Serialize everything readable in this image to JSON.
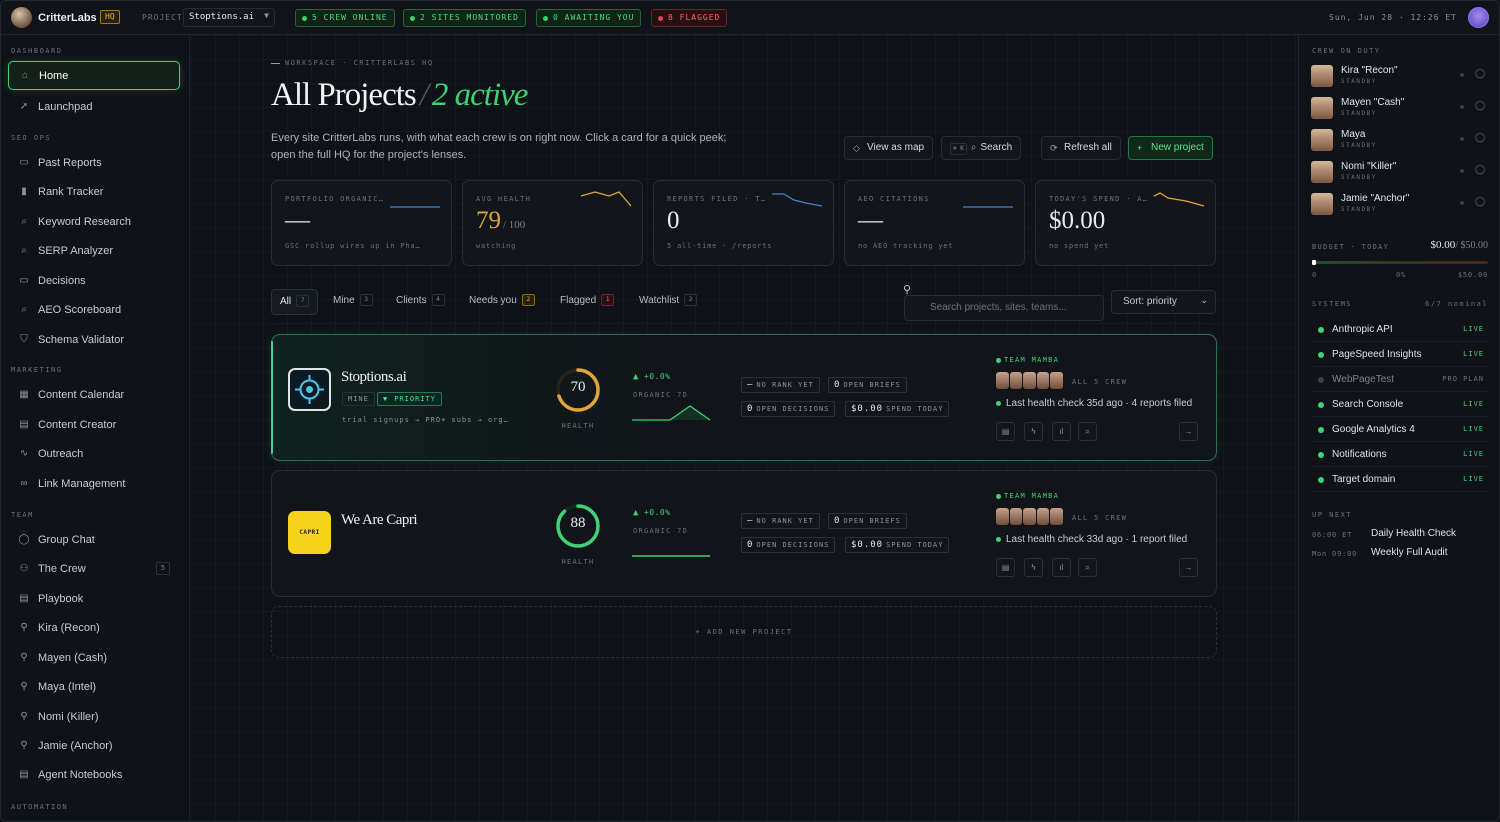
{
  "topbar": {
    "brand": "CritterLabs",
    "hq_badge": "HQ",
    "project_label": "PROJECT",
    "project_value": "Stoptions.ai",
    "pills": [
      "5 CREW ONLINE",
      "2 SITES MONITORED",
      "0 AWAITING YOU",
      "8 FLAGGED"
    ],
    "clock": "Sun, Jun 28 · 12:26 ET"
  },
  "sidebar": {
    "dashboard": "DASHBOARD",
    "seo_ops": "SEO OPS",
    "marketing": "MARKETING",
    "team": "TEAM",
    "automation": "AUTOMATION",
    "items": {
      "home": "Home",
      "launchpad": "Launchpad",
      "past_reports": "Past Reports",
      "rank_tracker": "Rank Tracker",
      "keyword_research": "Keyword Research",
      "serp_analyzer": "SERP Analyzer",
      "decisions": "Decisions",
      "aeo_scoreboard": "AEO Scoreboard",
      "schema_validator": "Schema Validator",
      "content_calendar": "Content Calendar",
      "content_creator": "Content Creator",
      "outreach": "Outreach",
      "link_management": "Link Management",
      "group_chat": "Group Chat",
      "the_crew": "The Crew",
      "the_crew_count": "5",
      "playbook": "Playbook",
      "kira": "Kira (Recon)",
      "mayen": "Mayen (Cash)",
      "maya": "Maya (Intel)",
      "nomi": "Nomi (Killer)",
      "jamie": "Jamie (Anchor)",
      "agent_notebooks": "Agent Notebooks"
    }
  },
  "main": {
    "breadcrumb": "WORKSPACE · CRITTERLABS HQ",
    "title": "All Projects",
    "title_slash": "/",
    "title_active": "2 active",
    "description": "Every site CritterLabs runs, with what each crew is on right now. Click a card for a quick peek; open the full HQ for the project's lenses.",
    "buttons": {
      "view_map": "View as map",
      "search_kbd": "⌘ K",
      "search": "Search",
      "refresh": "Refresh all",
      "new_project": "New project"
    },
    "stats": [
      {
        "label": "PORTFOLIO ORGANIC…",
        "value": "—",
        "unit": "",
        "sub": "GSC rollup wires up in Pha…"
      },
      {
        "label": "AVG HEALTH",
        "value": "79",
        "unit": "/ 100",
        "sub": "watching"
      },
      {
        "label": "REPORTS FILED · T…",
        "value": "0",
        "unit": "",
        "sub": "5 all-time · /reports"
      },
      {
        "label": "AEO CITATIONS",
        "value": "—",
        "unit": "",
        "sub": "no AEO tracking yet"
      },
      {
        "label": "TODAY'S SPEND · A…",
        "value": "$0.00",
        "unit": "",
        "sub": "no spend yet"
      }
    ],
    "filters": [
      {
        "label": "All",
        "count": "7"
      },
      {
        "label": "Mine",
        "count": "3"
      },
      {
        "label": "Clients",
        "count": "4"
      },
      {
        "label": "Needs you",
        "count": "2"
      },
      {
        "label": "Flagged",
        "count": "1"
      },
      {
        "label": "Watchlist",
        "count": "2"
      }
    ],
    "search_placeholder": "Search projects, sites, teams...",
    "sort": "Sort: priority",
    "projects": [
      {
        "name": "Stoptions.ai",
        "tag_mine": "MINE",
        "tag_priority": "PRIORITY",
        "goal": "trial signups → PRO+ subs → org…",
        "health": 70,
        "health_label": "HEALTH",
        "delta": "+0.0%",
        "organic_label": "ORGANIC 7D",
        "rank": "NO RANK YET",
        "rank_val": "—",
        "briefs_val": "0",
        "briefs": "OPEN BRIEFS",
        "decisions_val": "0",
        "decisions": "OPEN DECISIONS",
        "spend_val": "$0.00",
        "spend": "SPEND TODAY",
        "team": "TEAM MAMBA",
        "crew": "ALL 5 CREW",
        "check": "Last health check 35d ago · 4 reports filed"
      },
      {
        "name": "We Are Capri",
        "logo_text": "CAPRI",
        "goal": "",
        "health": 88,
        "health_label": "HEALTH",
        "delta": "+0.0%",
        "organic_label": "ORGANIC 7D",
        "rank": "NO RANK YET",
        "rank_val": "—",
        "briefs_val": "0",
        "briefs": "OPEN BRIEFS",
        "decisions_val": "0",
        "decisions": "OPEN DECISIONS",
        "spend_val": "$0.00",
        "spend": "SPEND TODAY",
        "team": "TEAM MAMBA",
        "crew": "ALL 5 CREW",
        "check": "Last health check 33d ago · 1 report filed"
      }
    ],
    "add_project": "+ ADD NEW PROJECT"
  },
  "right": {
    "crew_header": "CREW ON DUTY",
    "crew": [
      {
        "name": "Kira \"Recon\"",
        "status": "STANDBY"
      },
      {
        "name": "Mayen \"Cash\"",
        "status": "STANDBY"
      },
      {
        "name": "Maya",
        "status": "STANDBY"
      },
      {
        "name": "Nomi \"Killer\"",
        "status": "STANDBY"
      },
      {
        "name": "Jamie \"Anchor\"",
        "status": "STANDBY"
      }
    ],
    "budget_label": "BUDGET · TODAY",
    "budget_value": "$0.00",
    "budget_total": "/ $50.00",
    "budget_pct": 0,
    "budget_ticks": [
      "0",
      "0%",
      "$50.00"
    ],
    "systems_header": "SYSTEMS",
    "systems_count": "6/7 nominal",
    "systems": [
      {
        "name": "Anthropic API",
        "status": "LIVE",
        "on": true
      },
      {
        "name": "PageSpeed Insights",
        "status": "LIVE",
        "on": true
      },
      {
        "name": "WebPageTest",
        "status": "PRO PLAN",
        "on": false
      },
      {
        "name": "Search Console",
        "status": "LIVE",
        "on": true
      },
      {
        "name": "Google Analytics 4",
        "status": "LIVE",
        "on": true
      },
      {
        "name": "Notifications",
        "status": "LIVE",
        "on": true
      },
      {
        "name": "Target domain",
        "status": "LIVE",
        "on": true
      }
    ],
    "up_next_header": "UP NEXT",
    "up_next": [
      {
        "time": "06:00 ET",
        "name": "Daily Health Check"
      },
      {
        "time": "Mon 09:00",
        "name": "Weekly Full Audit"
      }
    ]
  },
  "colors": {
    "accent": "#3fd17a",
    "amber": "#e0a63a",
    "danger": "#e5484d",
    "background": "#0e1115"
  }
}
